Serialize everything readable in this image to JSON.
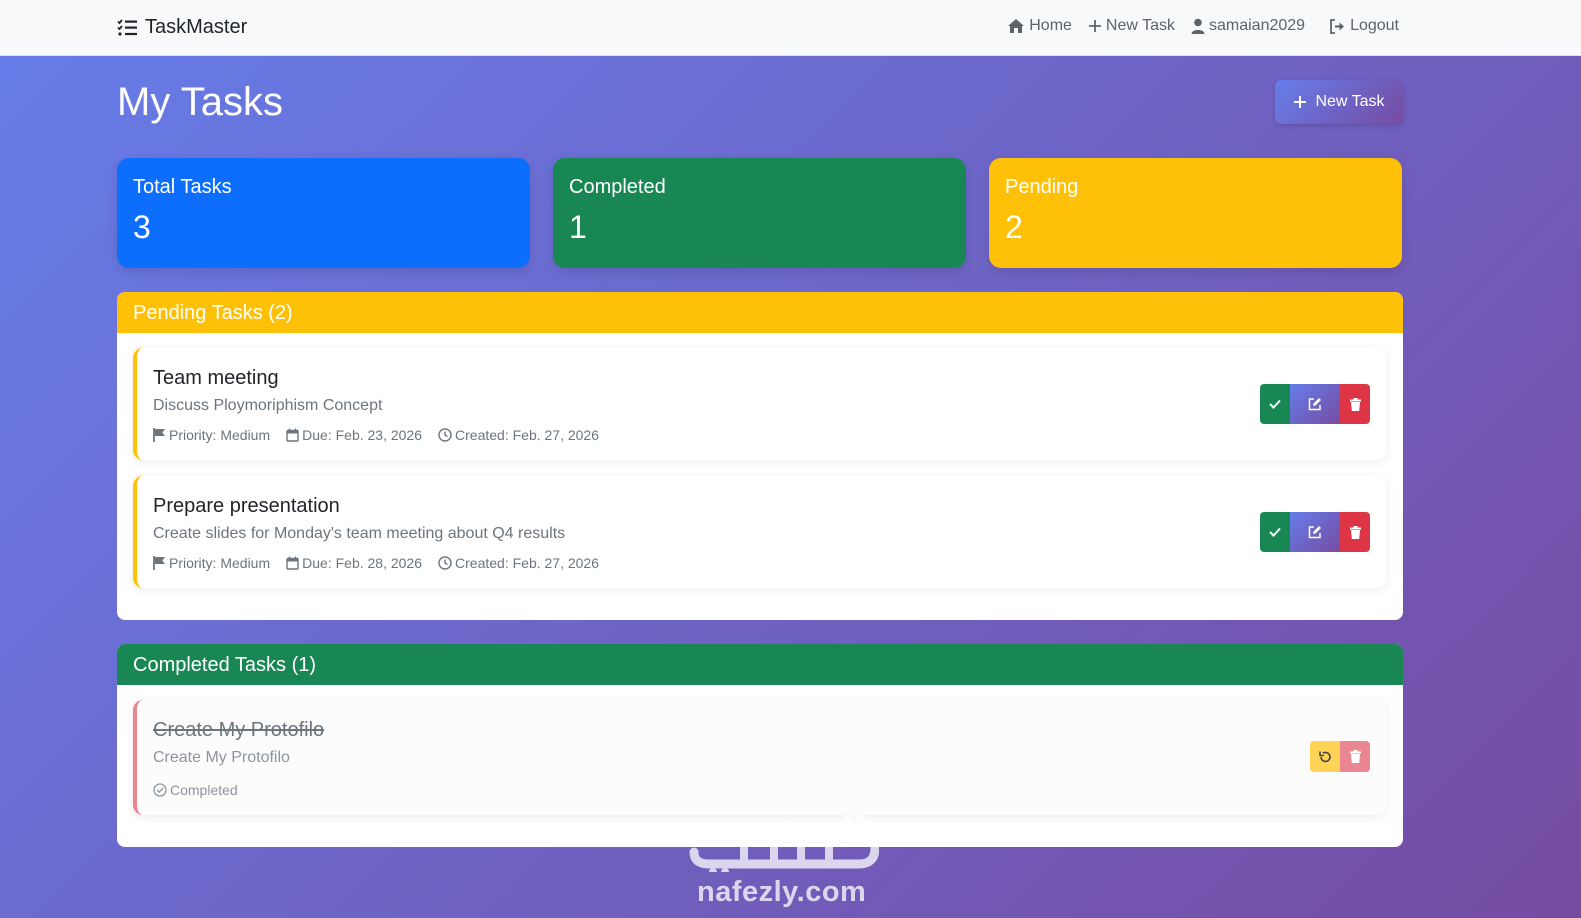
{
  "navbar": {
    "brand": "TaskMaster",
    "links": [
      {
        "icon": "home-icon",
        "label": "Home"
      },
      {
        "icon": "plus-icon",
        "label": "New Task"
      },
      {
        "icon": "user-icon",
        "label": "samaian2029"
      },
      {
        "icon": "logout-icon",
        "label": "Logout"
      }
    ]
  },
  "page": {
    "title": "My Tasks",
    "new_task_button": "New Task"
  },
  "stats": {
    "total": {
      "label": "Total Tasks",
      "value": "3",
      "color": "#0d6efd"
    },
    "completed": {
      "label": "Completed",
      "value": "1",
      "color": "#198754"
    },
    "pending": {
      "label": "Pending",
      "value": "2",
      "color": "#ffc107"
    }
  },
  "pending_section": {
    "header": "Pending Tasks (2)",
    "tasks": [
      {
        "title": "Team meeting",
        "description": "Discuss Ploymoriphism Concept",
        "priority": "Priority: Medium",
        "due": "Due: Feb. 23, 2026",
        "created": "Created: Feb. 27, 2026"
      },
      {
        "title": "Prepare presentation",
        "description": "Create slides for Monday's team meeting about Q4 results",
        "priority": "Priority: Medium",
        "due": "Due: Feb. 28, 2026",
        "created": "Created: Feb. 27, 2026"
      }
    ]
  },
  "completed_section": {
    "header": "Completed Tasks (1)",
    "tasks": [
      {
        "title": "Create My Protofilo",
        "description": "Create My Protofilo",
        "status": "Completed"
      }
    ]
  },
  "watermark": {
    "latin": "nafezly.com"
  },
  "colors": {
    "gradient_start": "#667eea",
    "gradient_end": "#764ba2",
    "success": "#198754",
    "warning": "#ffc107",
    "danger": "#dc3545",
    "primary": "#0d6efd"
  }
}
